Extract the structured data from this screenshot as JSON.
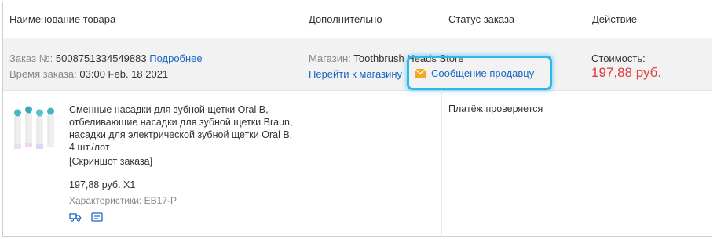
{
  "header": {
    "col_product": "Наименование товара",
    "col_extra": "Дополнительно",
    "col_status": "Статус заказа",
    "col_action": "Действие"
  },
  "order": {
    "number_label": "Заказ №:",
    "number": "5008751334549883",
    "details_link": "Подробнее",
    "time_label": "Время заказа:",
    "time": "03:00 Feb. 18 2021",
    "store_label": "Магазин:",
    "store_name": "Toothbrush Heads Store",
    "go_to_store": "Перейти к магазину",
    "message_seller": "Сообщение продавцу",
    "cost_label": "Стоимость:",
    "cost": "197,88 руб."
  },
  "item": {
    "title": "Сменные насадки для зубной щетки Oral B, отбеливающие насадки для зубной щетки Braun, насадки для электрической зубной щетки Oral B, 4 шт./лот",
    "snapshot": "[Скриншот заказа]",
    "price_qty": "197,88 руб. X1",
    "specs": "Характеристики: EB17-P",
    "status": "Платёж проверяется"
  },
  "colors": {
    "link": "#1a66c7",
    "price": "#e4393c",
    "highlight": "#2bb8ea",
    "info_bg": "#f2f2f2",
    "envelope": "#f5a623"
  },
  "icons": [
    "truck-icon",
    "message-box-icon",
    "envelope-icon"
  ]
}
